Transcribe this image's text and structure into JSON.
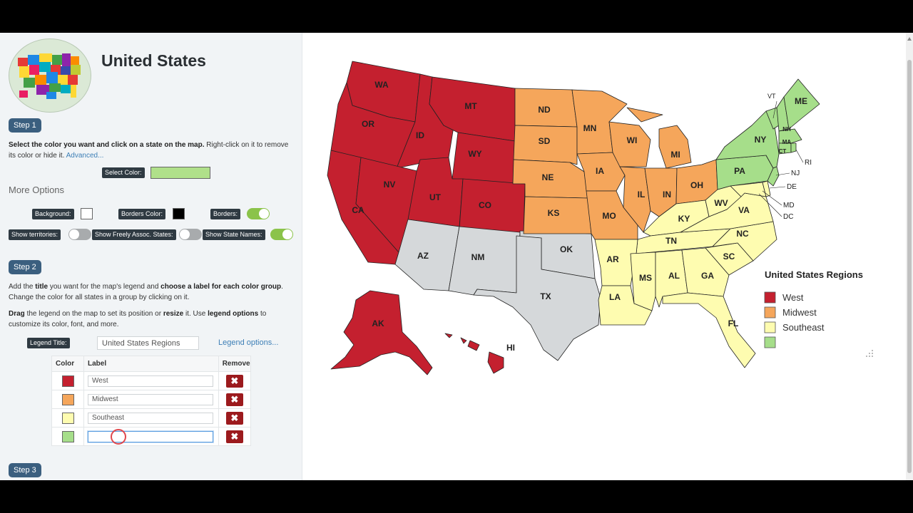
{
  "app": {
    "title": "United States"
  },
  "step1": {
    "badge": "Step 1",
    "instruction_bold": "Select the color you want and click on a state on the map.",
    "instruction_rest": " Right-click on it to remove its color or hide it. ",
    "advanced_link": "Advanced...",
    "select_color_label": "Select Color:",
    "selected_color": "#b0e08a"
  },
  "more_options": {
    "title": "More Options",
    "background_label": "Background:",
    "background_color": "#ffffff",
    "borders_color_label": "Borders Color:",
    "borders_color": "#000000",
    "borders_label": "Borders:",
    "show_territories_label": "Show territories:",
    "show_freely_label": "Show Freely Assoc. States:",
    "show_names_label": "Show State Names:"
  },
  "step2": {
    "badge": "Step 2",
    "p1_a": "Add the ",
    "p1_b": "title",
    "p1_c": " you want for the map's legend and ",
    "p1_d": "choose a label for each color group",
    "p1_e": ". Change the color for all states in a group by clicking on it.",
    "p2_a": "Drag",
    "p2_b": " the legend on the map to set its position or ",
    "p2_c": "resize",
    "p2_d": " it. Use ",
    "p2_e": "legend options",
    "p2_f": " to customize its color, font, and more.",
    "legend_title_label": "Legend Title:",
    "legend_title_value": "United States Regions",
    "legend_options_link": "Legend options...",
    "table_headers": [
      "Color",
      "Label",
      "Remove"
    ],
    "rows": [
      {
        "color": "#c4202f",
        "label": "West"
      },
      {
        "color": "#f5a65b",
        "label": "Midwest"
      },
      {
        "color": "#fefcb0",
        "label": "Southeast"
      },
      {
        "color": "#a6de8a",
        "label": ""
      }
    ],
    "remove_glyph": "✖"
  },
  "step3": {
    "badge": "Step 3"
  },
  "map": {
    "region_colors": {
      "west": "#c4202f",
      "midwest": "#f5a65b",
      "southeast": "#fefcb0",
      "northeast": "#a6de8a",
      "southwest": "#d5d8da"
    },
    "labels": {
      "WA": "WA",
      "OR": "OR",
      "CA": "CA",
      "ID": "ID",
      "NV": "NV",
      "MT": "MT",
      "WY": "WY",
      "UT": "UT",
      "CO": "CO",
      "AZ": "AZ",
      "NM": "NM",
      "TX": "TX",
      "OK": "OK",
      "ND": "ND",
      "SD": "SD",
      "NE": "NE",
      "KS": "KS",
      "MN": "MN",
      "IA": "IA",
      "MO": "MO",
      "WI": "WI",
      "IL": "IL",
      "IN": "IN",
      "MI": "MI",
      "OH": "OH",
      "AR": "AR",
      "LA": "LA",
      "MS": "MS",
      "AL": "AL",
      "GA": "GA",
      "FL": "FL",
      "TN": "TN",
      "KY": "KY",
      "SC": "SC",
      "NC": "NC",
      "VA": "VA",
      "WV": "WV",
      "PA": "PA",
      "NY": "NY",
      "ME": "ME",
      "NH": "NH",
      "VT": "VT",
      "MA": "MA",
      "CT": "CT",
      "RI": "RI",
      "NJ": "NJ",
      "DE": "DE",
      "MD": "MD",
      "DC": "DC",
      "AK": "AK",
      "HI": "HI"
    },
    "legend": {
      "title": "United States Regions",
      "items": [
        {
          "color": "#c4202f",
          "label": "West"
        },
        {
          "color": "#f5a65b",
          "label": "Midwest"
        },
        {
          "color": "#fefcb0",
          "label": "Southeast"
        },
        {
          "color": "#a6de8a",
          "label": ""
        }
      ]
    }
  }
}
